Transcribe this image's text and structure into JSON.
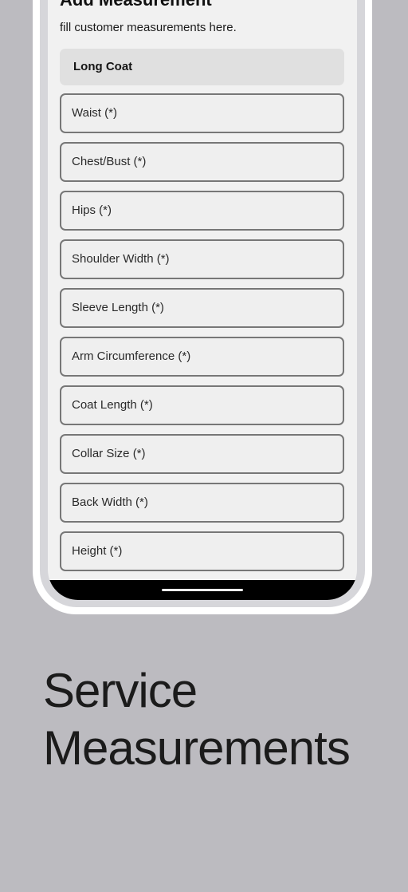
{
  "screen": {
    "title": "Add Measurement",
    "subtitle": "fill customer measurements here.",
    "service_name": "Long Coat",
    "fields": [
      {
        "placeholder": "Waist (*)"
      },
      {
        "placeholder": "Chest/Bust (*)"
      },
      {
        "placeholder": "Hips (*)"
      },
      {
        "placeholder": "Shoulder Width (*)"
      },
      {
        "placeholder": "Sleeve Length (*)"
      },
      {
        "placeholder": "Arm Circumference (*)"
      },
      {
        "placeholder": "Coat Length (*)"
      },
      {
        "placeholder": "Collar Size (*)"
      },
      {
        "placeholder": "Back Width (*)"
      },
      {
        "placeholder": "Height (*)"
      }
    ]
  },
  "headline": {
    "line1": "Service",
    "line2": "Measurements"
  },
  "colors": {
    "background": "#bcbbc0",
    "frame": "#ffffff",
    "screen": "#f1f1f1"
  }
}
